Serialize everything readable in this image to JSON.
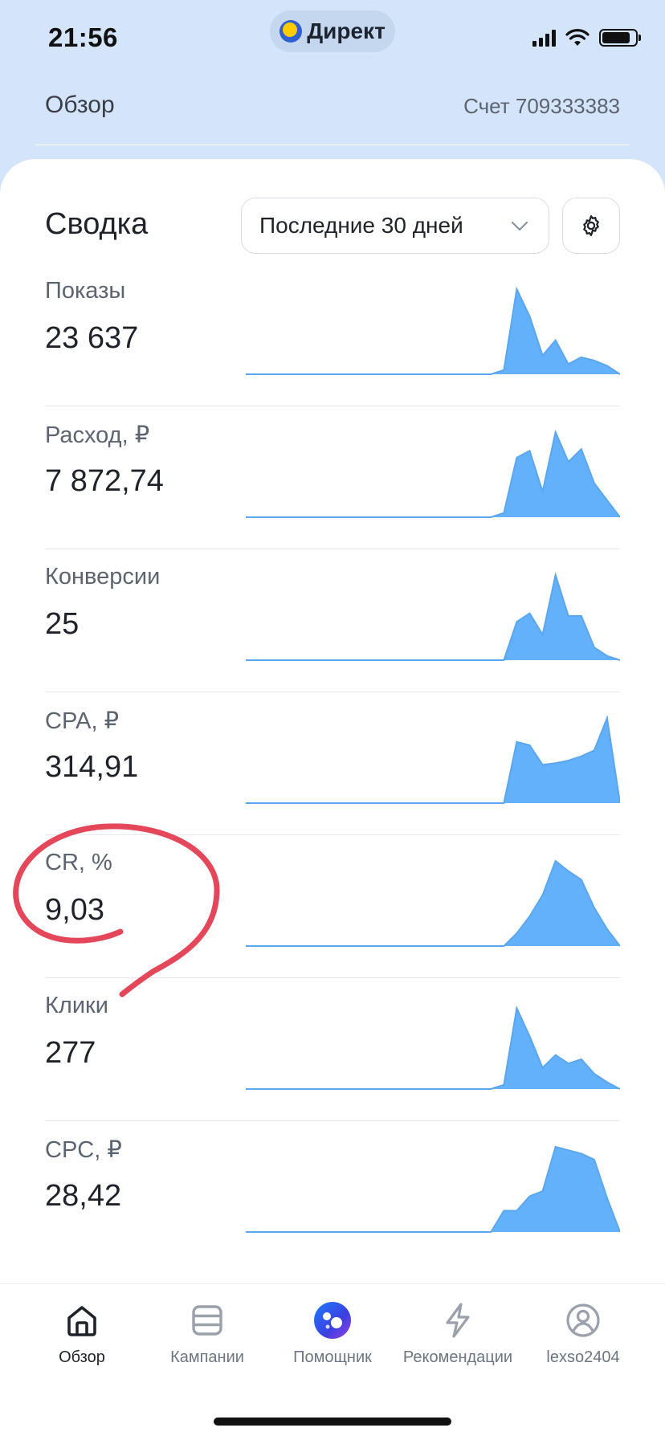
{
  "status_bar": {
    "time": "21:56",
    "app_name": "Директ"
  },
  "header": {
    "title": "Обзор",
    "account": "Счет 709333383"
  },
  "summary": {
    "title": "Сводка",
    "period": "Последние 30 дней"
  },
  "colors": {
    "sparkline_fill": "#64b1fb",
    "sparkline_line": "#5aa6ef",
    "annotation": "#e5475a",
    "background": "#d3e4fb"
  },
  "metrics": [
    {
      "label": "Показы",
      "value": "23 637",
      "trend": [
        0,
        0,
        0,
        0,
        0,
        0,
        0,
        0,
        0,
        0,
        0,
        0,
        0,
        0,
        0,
        0,
        0,
        0,
        0,
        0,
        0.05,
        1.0,
        0.68,
        0.22,
        0.4,
        0.12,
        0.2,
        0.16,
        0.1,
        0.0
      ]
    },
    {
      "label": "Расход, ₽",
      "value": "7 872,74",
      "trend": [
        0,
        0,
        0,
        0,
        0,
        0,
        0,
        0,
        0,
        0,
        0,
        0,
        0,
        0,
        0,
        0,
        0,
        0,
        0,
        0,
        0.05,
        0.7,
        0.78,
        0.3,
        1.0,
        0.65,
        0.8,
        0.4,
        0.2,
        0.0
      ]
    },
    {
      "label": "Конверсии",
      "value": "25",
      "trend": [
        0,
        0,
        0,
        0,
        0,
        0,
        0,
        0,
        0,
        0,
        0,
        0,
        0,
        0,
        0,
        0,
        0,
        0,
        0,
        0,
        0,
        0.45,
        0.55,
        0.3,
        1.0,
        0.52,
        0.52,
        0.15,
        0.05,
        0.0
      ]
    },
    {
      "label": "CPA, ₽",
      "value": "314,91",
      "trend": [
        0,
        0,
        0,
        0,
        0,
        0,
        0,
        0,
        0,
        0,
        0,
        0,
        0,
        0,
        0,
        0,
        0,
        0,
        0,
        0,
        0,
        0.72,
        0.68,
        0.45,
        0.47,
        0.5,
        0.55,
        0.62,
        1.0,
        0.0
      ]
    },
    {
      "label": "CR, %",
      "value": "9,03",
      "trend": [
        0,
        0,
        0,
        0,
        0,
        0,
        0,
        0,
        0,
        0,
        0,
        0,
        0,
        0,
        0,
        0,
        0,
        0,
        0,
        0,
        0,
        0.15,
        0.35,
        0.6,
        1.0,
        0.88,
        0.78,
        0.45,
        0.2,
        0.0
      ]
    },
    {
      "label": "Клики",
      "value": "277",
      "trend": [
        0,
        0,
        0,
        0,
        0,
        0,
        0,
        0,
        0,
        0,
        0,
        0,
        0,
        0,
        0,
        0,
        0,
        0,
        0,
        0,
        0.05,
        0.95,
        0.62,
        0.25,
        0.4,
        0.3,
        0.35,
        0.18,
        0.08,
        0.0
      ]
    },
    {
      "label": "CPC, ₽",
      "value": "28,42",
      "trend": [
        0,
        0,
        0,
        0,
        0,
        0,
        0,
        0,
        0,
        0,
        0,
        0,
        0,
        0,
        0,
        0,
        0,
        0,
        0,
        0,
        0.25,
        0.25,
        0.42,
        0.48,
        1.0,
        0.96,
        0.92,
        0.85,
        0.4,
        0.0
      ]
    }
  ],
  "nav": [
    {
      "label": "Обзор",
      "icon": "home-icon",
      "active": true
    },
    {
      "label": "Кампании",
      "icon": "campaigns-icon",
      "active": false
    },
    {
      "label": "Помощник",
      "icon": "assistant-icon",
      "active": false
    },
    {
      "label": "Рекомендации",
      "icon": "lightning-icon",
      "active": false
    },
    {
      "label": "lexso2404",
      "icon": "profile-icon",
      "active": false
    }
  ]
}
